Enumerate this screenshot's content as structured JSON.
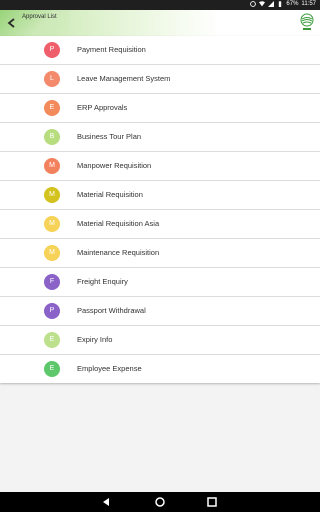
{
  "status_bar": {
    "battery": "67%",
    "time": "11:57"
  },
  "header": {
    "title": "Approval List"
  },
  "items": [
    {
      "letter": "P",
      "label": "Payment Requisition",
      "color": "#ef5f6b"
    },
    {
      "letter": "L",
      "label": "Leave Management System",
      "color": "#f28a6b"
    },
    {
      "letter": "E",
      "label": "ERP Approvals",
      "color": "#f28a5c"
    },
    {
      "letter": "B",
      "label": "Business Tour Plan",
      "color": "#b7dd7e"
    },
    {
      "letter": "M",
      "label": "Manpower Requisition",
      "color": "#f2825e"
    },
    {
      "letter": "M",
      "label": "Material Requisition",
      "color": "#d4c21e"
    },
    {
      "letter": "M",
      "label": "Material Requisition Asia",
      "color": "#f6d257"
    },
    {
      "letter": "M",
      "label": "Maintenance Requisition",
      "color": "#f6d257"
    },
    {
      "letter": "F",
      "label": "Freight Enquiry",
      "color": "#8a62c8"
    },
    {
      "letter": "P",
      "label": "Passport Withdrawal",
      "color": "#8a62c8"
    },
    {
      "letter": "E",
      "label": "Expiry Info",
      "color": "#bde08c"
    },
    {
      "letter": "E",
      "label": "Employee Expense",
      "color": "#5cc76b"
    }
  ],
  "icons": {
    "back": "back-arrow-icon",
    "logo": "company-logo",
    "nav_back": "nav-back-icon",
    "nav_home": "nav-home-icon",
    "nav_recents": "nav-recents-icon"
  }
}
